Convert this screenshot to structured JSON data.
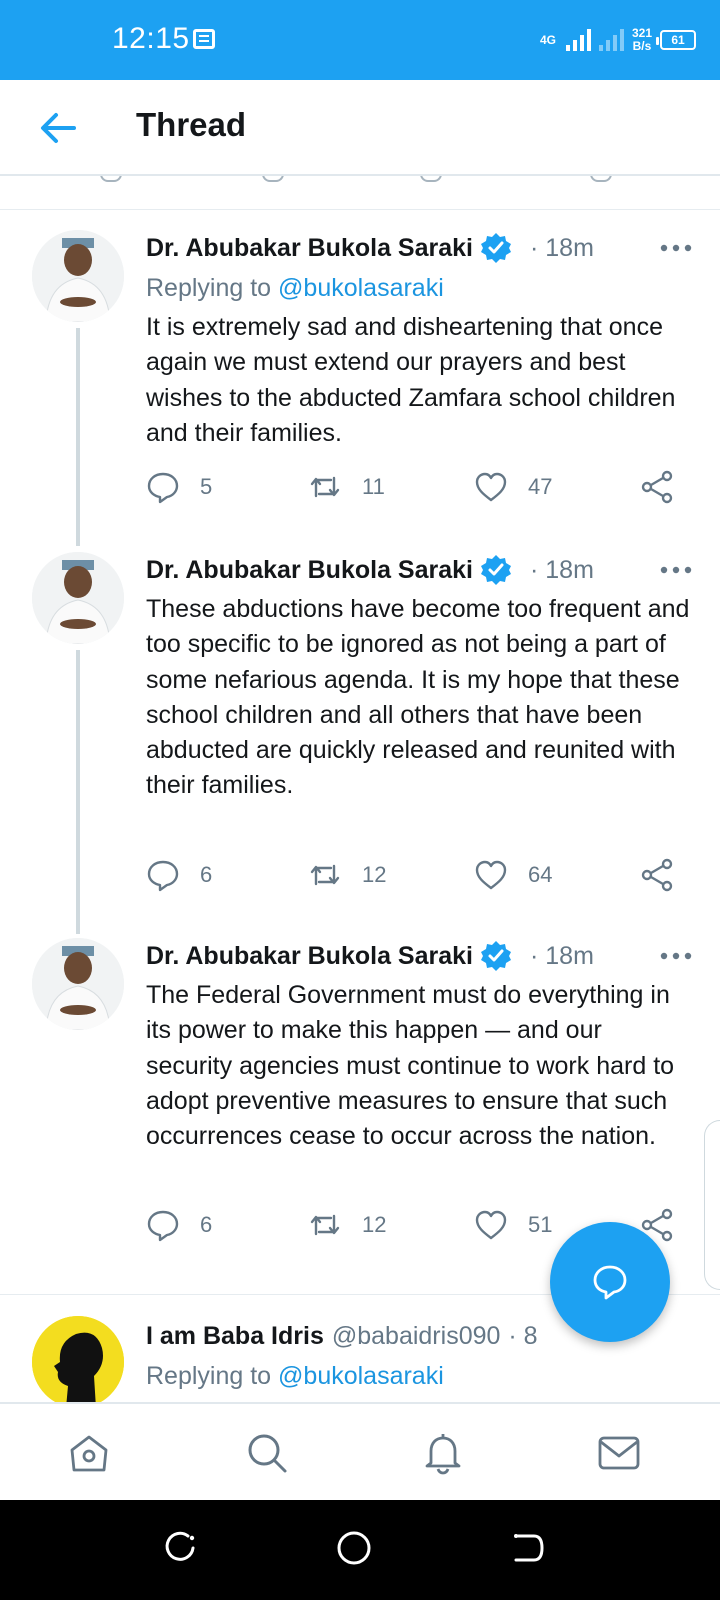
{
  "status_bar": {
    "time": "12:15",
    "network": "4G",
    "speed_value": "321",
    "speed_unit": "B/s",
    "battery": "61"
  },
  "header": {
    "title": "Thread",
    "back_icon": "arrow-left-icon"
  },
  "tweets": [
    {
      "name": "Dr. Abubakar Bukola Saraki",
      "time": "· 18m",
      "replying_prefix": "Replying to ",
      "replying_to": "@bukolasaraki",
      "text": "It is extremely sad and disheartening that once again we must extend our prayers and best wishes to the abducted Zamfara school children and their families.",
      "replies": "5",
      "retweets": "11",
      "likes": "47"
    },
    {
      "name": "Dr. Abubakar Bukola Saraki",
      "time": "· 18m",
      "text": "These abductions have become too frequent and too specific to be ignored as not being a part of some nefarious agenda. It is my hope that these school children and all others that have been abducted are quickly released and reunited with their families.",
      "replies": "6",
      "retweets": "12",
      "likes": "64"
    },
    {
      "name": "Dr. Abubakar Bukola Saraki",
      "time": "· 18m",
      "text": "The Federal Government must do everything in its power to make this happen — and our security agencies must continue to work hard to adopt preventive measures to ensure that such occurrences cease to occur across the nation.",
      "replies": "6",
      "retweets": "12",
      "likes": "51"
    },
    {
      "name": "I am Baba Idris",
      "handle": "@babaidris090",
      "time": "· 8",
      "replying_prefix": "Replying to ",
      "replying_to": "@bukolasaraki"
    }
  ],
  "fab": {
    "icon": "compose-reply-icon"
  },
  "bottom_nav": [
    "home-icon",
    "search-icon",
    "bell-icon",
    "mail-icon"
  ],
  "system_nav": [
    "recents-icon",
    "home-circle-icon",
    "back-icon"
  ],
  "colors": {
    "brand": "#1da1f2",
    "text": "#14171a",
    "muted": "#657786",
    "link": "#1b95e0"
  }
}
